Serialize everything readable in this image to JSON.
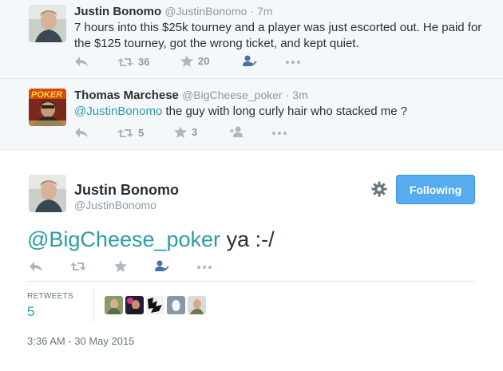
{
  "tweet1": {
    "name": "Justin Bonomo",
    "handle": "@JustinBonomo",
    "time": "· 7m",
    "text": "7 hours into this $25k tourney and a player was just escorted out. He paid for the $125 tourney, got the wrong ticket, and kept quiet.",
    "retweets": "36",
    "favorites": "20"
  },
  "tweet2": {
    "name": "Thomas Marchese",
    "handle": "@BigCheese_poker",
    "time": "· 3m",
    "mention": "@JustinBonomo",
    "text": " the guy with long curly hair who stacked me ?",
    "retweets": "5",
    "favorites": "3",
    "avatar_text": "POKER"
  },
  "main_tweet": {
    "name": "Justin Bonomo",
    "handle": "@JustinBonomo",
    "mention": "@BigCheese_poker",
    "text": " ya :-/",
    "follow_label": "Following",
    "retweets_label": "RETWEETS",
    "retweets_count": "5",
    "timestamp": "3:36 AM - 30 May 2015"
  },
  "colors": {
    "accent": "#55acee",
    "mention": "#2b9ca6",
    "icon": "#aab8c2"
  }
}
